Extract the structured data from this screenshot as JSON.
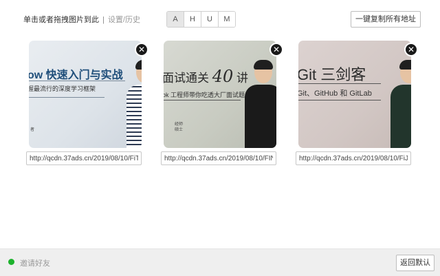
{
  "toolbar": {
    "hint_text": "单击或者拖拽图片到此",
    "separator": "|",
    "settings_link": "设置/历史",
    "filters": [
      "A",
      "H",
      "U",
      "M"
    ],
    "active_filter": "A",
    "copy_all_label": "一键复制所有地址"
  },
  "cards": [
    {
      "title_main": "ow 快速入门与实战",
      "title_big": "",
      "subtitle": "握最流行的深度学习框架",
      "small_text": "者",
      "close_icon": "✕",
      "url": "http://qcdn.37ads.cn/2019/08/10/FiT..."
    },
    {
      "title_main": "面试通关",
      "title_big": "40",
      "title_suffix": "讲",
      "subtitle": "ok 工程师带你吃透大厂面试题",
      "small_text": "经师\n硕士",
      "close_icon": "✕",
      "url": "http://qcdn.37ads.cn/2019/08/10/FIN..."
    },
    {
      "title_main": "Git 三剑客",
      "title_big": "",
      "subtitle": "Git、GitHub 和 GitLab",
      "small_text": "",
      "close_icon": "✕",
      "url": "http://qcdn.37ads.cn/2019/08/10/FiJl..."
    }
  ],
  "footer": {
    "invite_label": "邀请好友",
    "reset_label": "返回默认",
    "status_color": "#1db32d"
  }
}
